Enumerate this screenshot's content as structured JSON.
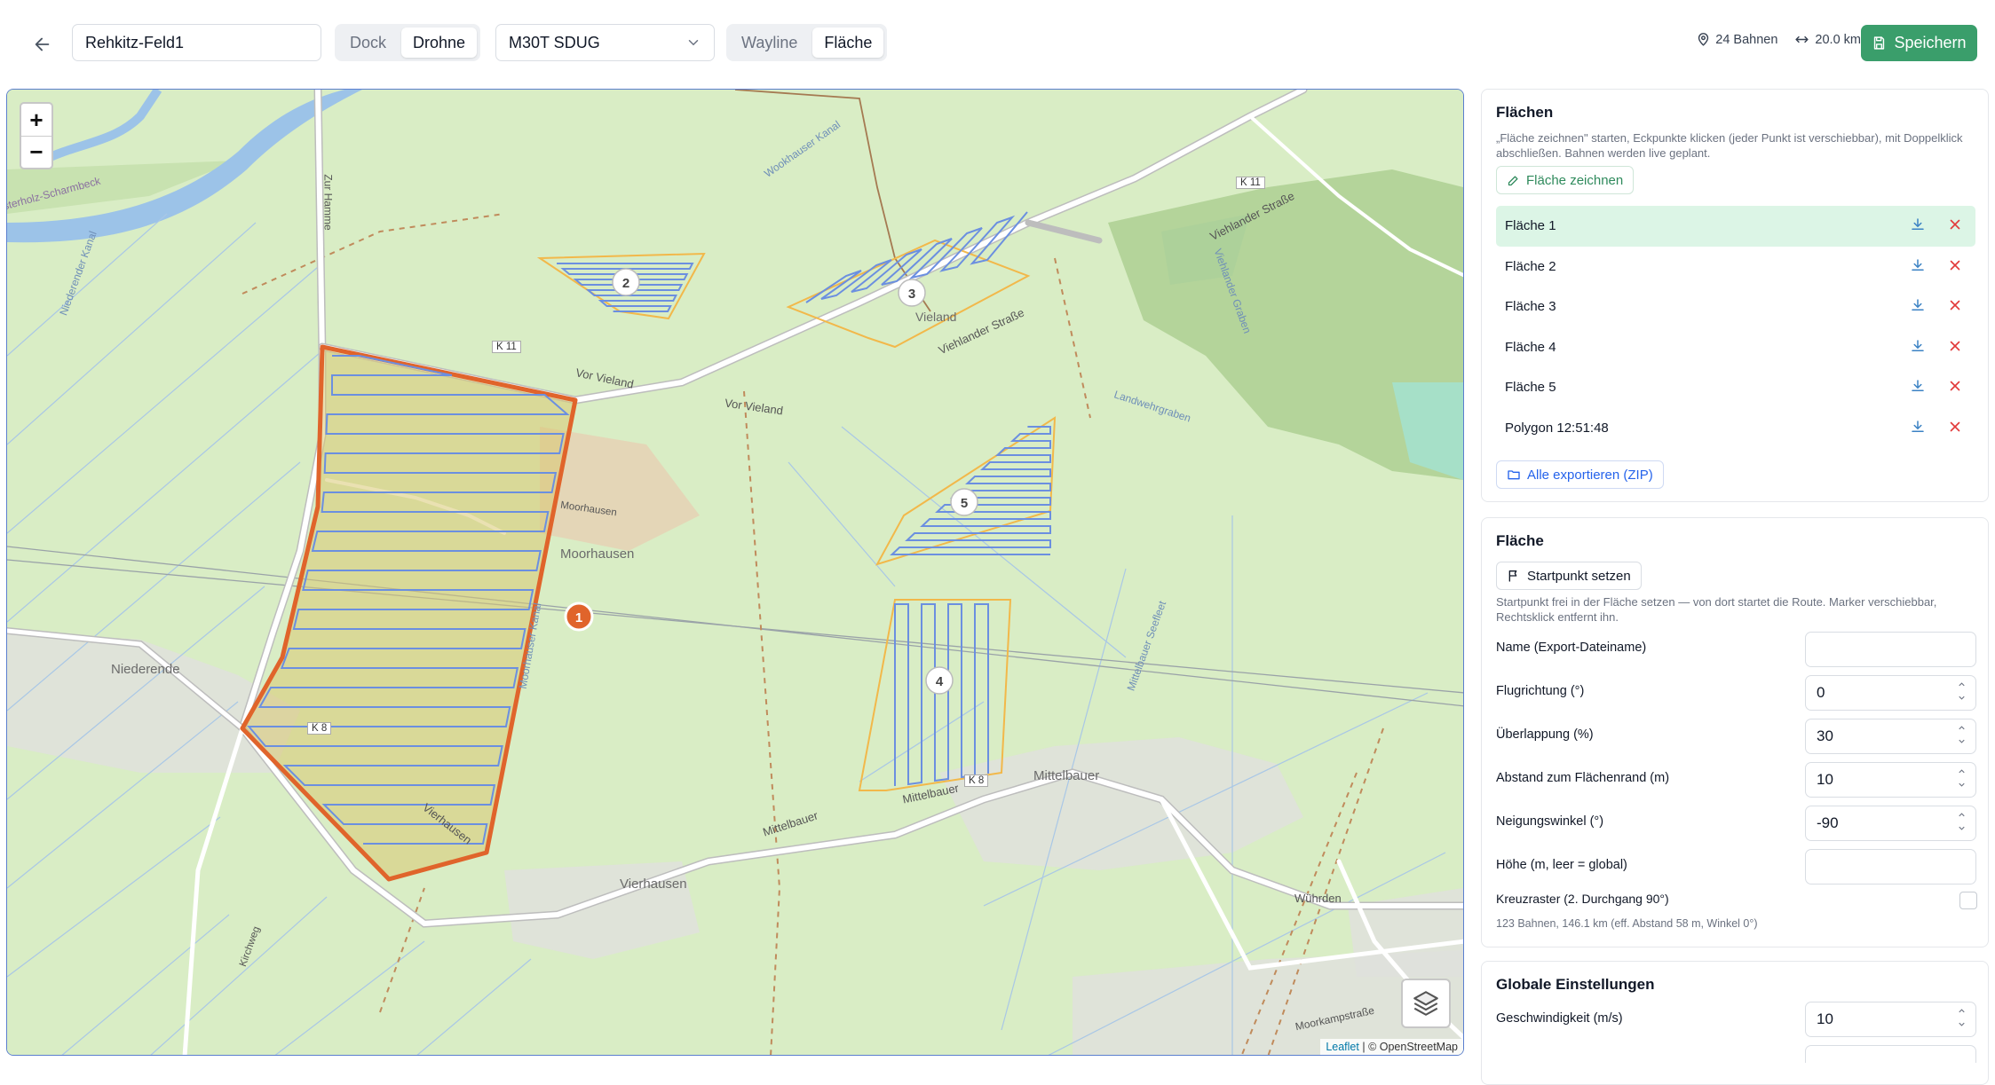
{
  "header": {
    "field_name": "Rehkitz-Feld1",
    "source_tabs": [
      {
        "label": "Dock",
        "active": false
      },
      {
        "label": "Drohne",
        "active": true
      }
    ],
    "drone_model": "M30T SDUG",
    "mode_tabs": [
      {
        "label": "Wayline",
        "active": false
      },
      {
        "label": "Fläche",
        "active": true
      }
    ],
    "lanes_count": "24 Bahnen",
    "distance": "20.0 km",
    "save_label": "Speichern"
  },
  "map": {
    "zoom_in": "+",
    "zoom_out": "−",
    "attribution_leaflet": "Leaflet",
    "attribution_rest": "| © OpenStreetMap",
    "places": [
      {
        "label": "Moorhausen"
      },
      {
        "label": "Niederende"
      },
      {
        "label": "Vierhausen"
      },
      {
        "label": "Mittelbauer"
      },
      {
        "label": "Vieland"
      }
    ],
    "roads": [
      {
        "label": "Vor Vieland"
      },
      {
        "label": "Vor Vieland"
      },
      {
        "label": "Viehlander Straße"
      },
      {
        "label": "Viehlander Straße"
      },
      {
        "label": "Mittelbauer"
      },
      {
        "label": "Mittelbauer"
      },
      {
        "label": "Vierhausen"
      },
      {
        "label": "Wührden"
      },
      {
        "label": "Moorkampstraße"
      },
      {
        "label": "Zur Hamme"
      },
      {
        "label": "K 11"
      },
      {
        "label": "K 11"
      },
      {
        "label": "K 8"
      },
      {
        "label": "K 8"
      },
      {
        "label": "Landwehrgraben"
      },
      {
        "label": "Wookhauser Kanal"
      },
      {
        "label": "Niederender Kanal"
      },
      {
        "label": "Moorhauser Kanal"
      },
      {
        "label": "Mittelbauer Seefleet"
      },
      {
        "label": "Viehlander Graben"
      },
      {
        "label": "Moorhausen"
      },
      {
        "label": "Kirchweg"
      },
      {
        "label": "sterholz-Scharmbeck"
      }
    ],
    "area_markers": [
      "1",
      "2",
      "3",
      "4",
      "5"
    ],
    "colors": {
      "main_area": "#e0642b",
      "other_area": "#f2b84a",
      "lanes": "#6b8fe0"
    }
  },
  "areas_panel": {
    "title": "Flächen",
    "hint": "„Fläche zeichnen\" starten, Eckpunkte klicken (jeder Punkt ist verschiebbar), mit Doppelklick abschließen. Bahnen werden live geplant.",
    "draw_label": "Fläche zeichnen",
    "items": [
      {
        "label": "Fläche 1",
        "active": true
      },
      {
        "label": "Fläche 2",
        "active": false
      },
      {
        "label": "Fläche 3",
        "active": false
      },
      {
        "label": "Fläche 4",
        "active": false
      },
      {
        "label": "Fläche 5",
        "active": false
      },
      {
        "label": "Polygon 12:51:48",
        "active": false
      }
    ],
    "export_label": "Alle exportieren (ZIP)"
  },
  "area_panel": {
    "title": "Fläche",
    "start_label": "Startpunkt setzen",
    "start_hint": "Startpunkt frei in der Fläche setzen — von dort startet die Route. Marker verschiebbar, Rechtsklick entfernt ihn.",
    "fields": [
      {
        "label": "Name (Export-Dateiname)",
        "value": "",
        "spinner": false
      },
      {
        "label": "Flugrichtung (°)",
        "value": "0",
        "spinner": true
      },
      {
        "label": "Überlappung (%)",
        "value": "30",
        "spinner": true
      },
      {
        "label": "Abstand zum Flächenrand (m)",
        "value": "10",
        "spinner": true
      },
      {
        "label": "Neigungswinkel (°)",
        "value": "-90",
        "spinner": true
      },
      {
        "label": "Höhe (m, leer = global)",
        "value": "",
        "spinner": false
      }
    ],
    "cross_label": "Kreuzraster (2. Durchgang 90°)",
    "cross_checked": false,
    "summary": "123 Bahnen, 146.1 km (eff. Abstand 58 m, Winkel 0°)"
  },
  "global_panel": {
    "title": "Globale Einstellungen",
    "speed_label": "Geschwindigkeit (m/s)",
    "speed_value": "10"
  }
}
